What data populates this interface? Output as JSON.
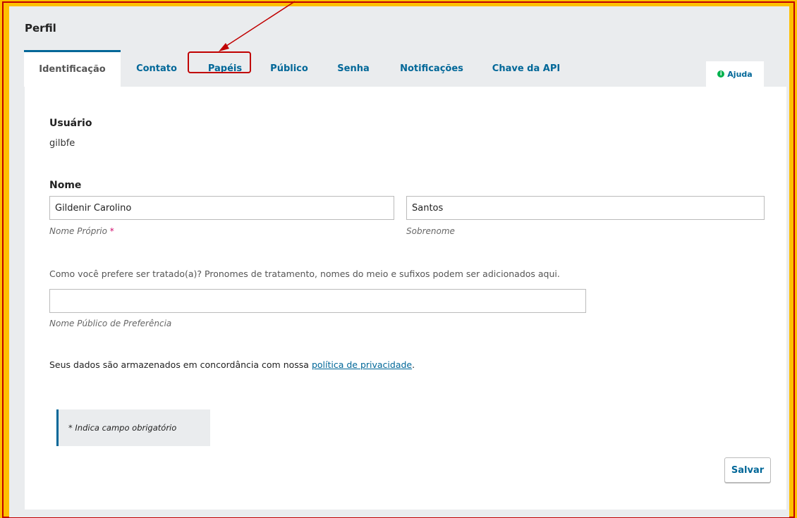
{
  "page": {
    "title": "Perfil"
  },
  "tabs": [
    {
      "label": "Identificação",
      "active": true
    },
    {
      "label": "Contato"
    },
    {
      "label": "Papéis"
    },
    {
      "label": "Público"
    },
    {
      "label": "Senha"
    },
    {
      "label": "Notificações"
    },
    {
      "label": "Chave da API"
    }
  ],
  "help": {
    "label": "Ajuda",
    "icon": "info-icon"
  },
  "annotation": {
    "target_tab": "Papéis",
    "color": "#c00000"
  },
  "form": {
    "username_label": "Usuário",
    "username_value": "gilbfe",
    "name_label": "Nome",
    "given_name": {
      "value": "Gildenir Carolino",
      "hint": "Nome Próprio",
      "required_mark": "*"
    },
    "family_name": {
      "value": "Santos",
      "hint": "Sobrenome"
    },
    "preferred_description": "Como você prefere ser tratado(a)? Pronomes de tratamento, nomes do meio e sufixos podem ser adicionados aqui.",
    "preferred_name": {
      "value": "",
      "hint": "Nome Público de Preferência"
    },
    "privacy_text_before": "Seus dados são armazenados em concordância com nossa ",
    "privacy_link": "política de privacidade",
    "privacy_text_after": ".",
    "required_note": "* Indica campo obrigatório",
    "save_label": "Salvar"
  },
  "colors": {
    "background": "#ffc000",
    "accent": "#006798",
    "required": "#d00a6c"
  }
}
